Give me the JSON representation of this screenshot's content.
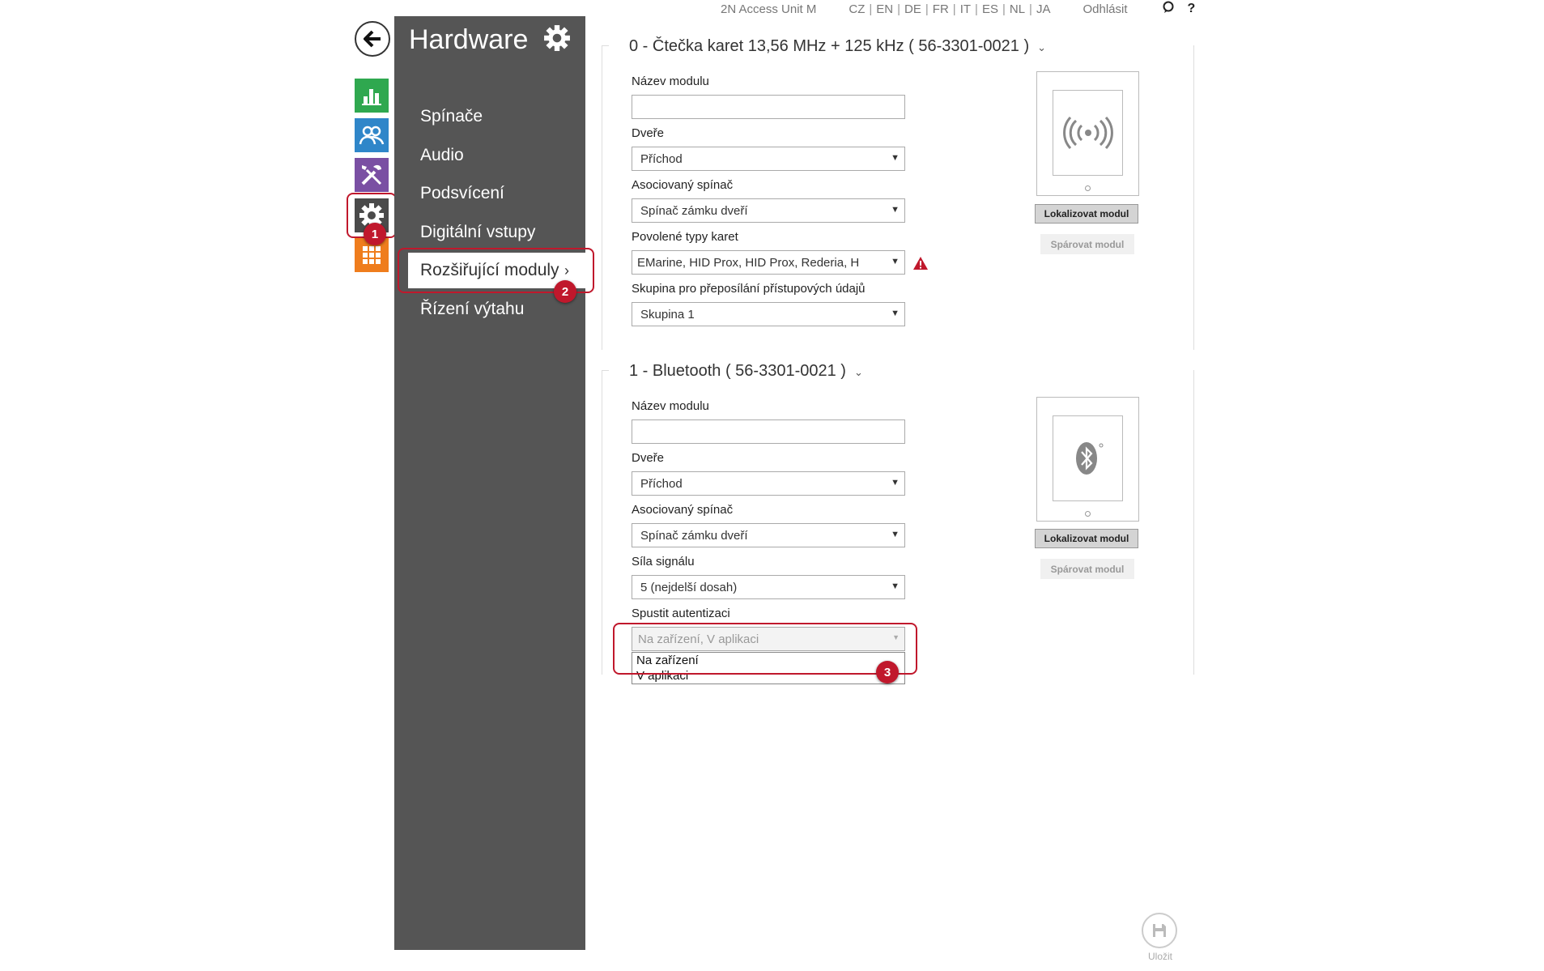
{
  "topbar": {
    "device_name": "2N Access Unit M",
    "languages": [
      "CZ",
      "EN",
      "DE",
      "FR",
      "IT",
      "ES",
      "NL",
      "JA"
    ],
    "logout": "Odhlásit",
    "help": "?"
  },
  "rail": {
    "items": [
      {
        "name": "Status",
        "icon": "bar-chart-icon",
        "color": "#2fa84f"
      },
      {
        "name": "Users",
        "icon": "users-icon",
        "color": "#2f86c9"
      },
      {
        "name": "Services",
        "icon": "tools-icon",
        "color": "#7a4fa3"
      },
      {
        "name": "Hardware",
        "icon": "gear-icon",
        "color": "#4a4a4a"
      },
      {
        "name": "System",
        "icon": "grid-icon",
        "color": "#ef7d1d"
      }
    ]
  },
  "nav": {
    "title": "Hardware",
    "items": [
      {
        "label": "Spínače"
      },
      {
        "label": "Audio"
      },
      {
        "label": "Podsvícení"
      },
      {
        "label": "Digitální vstupy"
      },
      {
        "label": "Rozšiřující moduly",
        "active": true
      },
      {
        "label": "Řízení výtahu"
      }
    ]
  },
  "annotations": {
    "one": "1",
    "two": "2",
    "three": "3",
    "color": "#c0182c"
  },
  "module0": {
    "title": "0 - Čtečka karet 13,56 MHz + 125 kHz ( 56-3301-0021 )",
    "name_label": "Název modulu",
    "name_value": "",
    "door_label": "Dveře",
    "door_value": "Příchod",
    "switch_label": "Asociovaný spínač",
    "switch_value": "Spínač zámku dveří",
    "cards_label": "Povolené typy karet",
    "cards_value": "EMarine, HID Prox, HID Prox, Rederia, H",
    "group_label": "Skupina pro přeposílání přístupových údajů",
    "group_value": "Skupina 1",
    "locate_button": "Lokalizovat modul",
    "pair_button": "Spárovat modul"
  },
  "module1": {
    "title": "1 - Bluetooth ( 56-3301-0021 )",
    "name_label": "Název modulu",
    "name_value": "",
    "door_label": "Dveře",
    "door_value": "Příchod",
    "switch_label": "Asociovaný spínač",
    "switch_value": "Spínač zámku dveří",
    "signal_label": "Síla signálu",
    "signal_value": "5 (nejdelší dosah)",
    "auth_label": "Spustit autentizaci",
    "auth_value": "Na zařízení, V aplikaci",
    "auth_options": [
      "Na zařízení",
      "V aplikaci"
    ],
    "locate_button": "Lokalizovat modul",
    "pair_button": "Spárovat modul"
  },
  "save": {
    "label": "Uložit"
  }
}
